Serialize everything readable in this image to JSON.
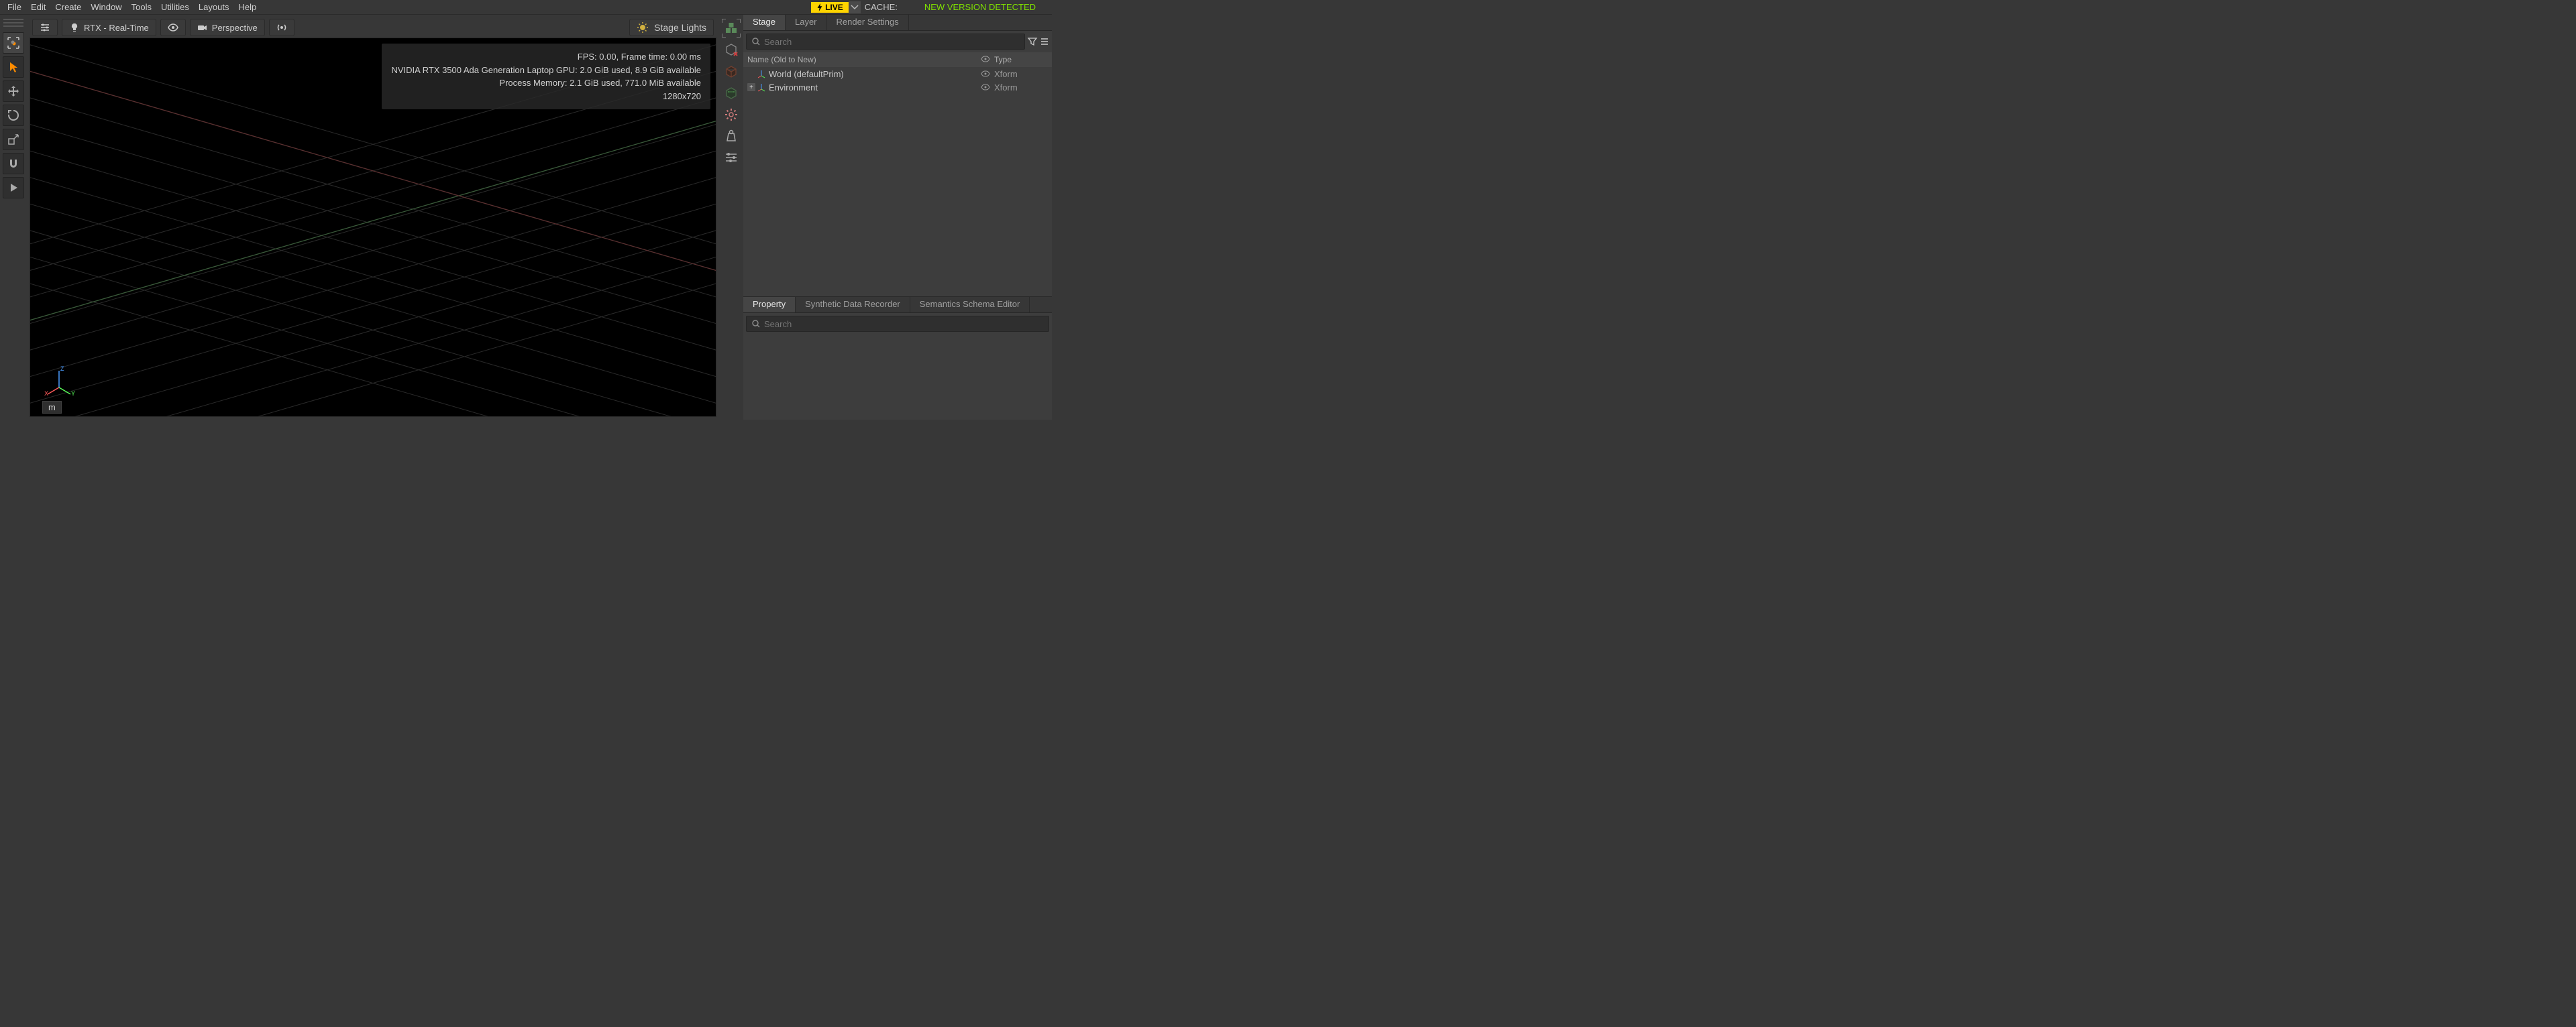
{
  "menubar": [
    "File",
    "Edit",
    "Create",
    "Window",
    "Tools",
    "Utilities",
    "Layouts",
    "Help"
  ],
  "topbar": {
    "live_label": "LIVE",
    "cache_label": "CACHE:",
    "version_label": "NEW VERSION DETECTED"
  },
  "viewport_toolbar": {
    "renderer_label": "RTX - Real-Time",
    "camera_label": "Perspective",
    "stage_lights_label": "Stage Lights"
  },
  "hud": {
    "line1": "FPS: 0.00, Frame time: 0.00 ms",
    "line2": "NVIDIA RTX 3500 Ada Generation Laptop GPU: 2.0 GiB used, 8.9 GiB available",
    "line3": "Process Memory: 2.1 GiB used, 771.0 MiB available",
    "line4": "1280x720"
  },
  "axis_labels": {
    "x": "X",
    "y": "Y",
    "z": "Z"
  },
  "units_label": "m",
  "stage_tabs": [
    "Stage",
    "Layer",
    "Render Settings"
  ],
  "stage_active_tab": "Stage",
  "stage_search_placeholder": "Search",
  "stage_columns": {
    "name": "Name (Old to New)",
    "type": "Type"
  },
  "stage_tree": [
    {
      "indent": 1,
      "expandable": false,
      "label": "World (defaultPrim)",
      "type": "Xform"
    },
    {
      "indent": 0,
      "expandable": true,
      "label": "Environment",
      "type": "Xform"
    }
  ],
  "property_tabs": [
    "Property",
    "Synthetic Data Recorder",
    "Semantics Schema Editor"
  ],
  "property_active_tab": "Property",
  "property_search_placeholder": "Search"
}
